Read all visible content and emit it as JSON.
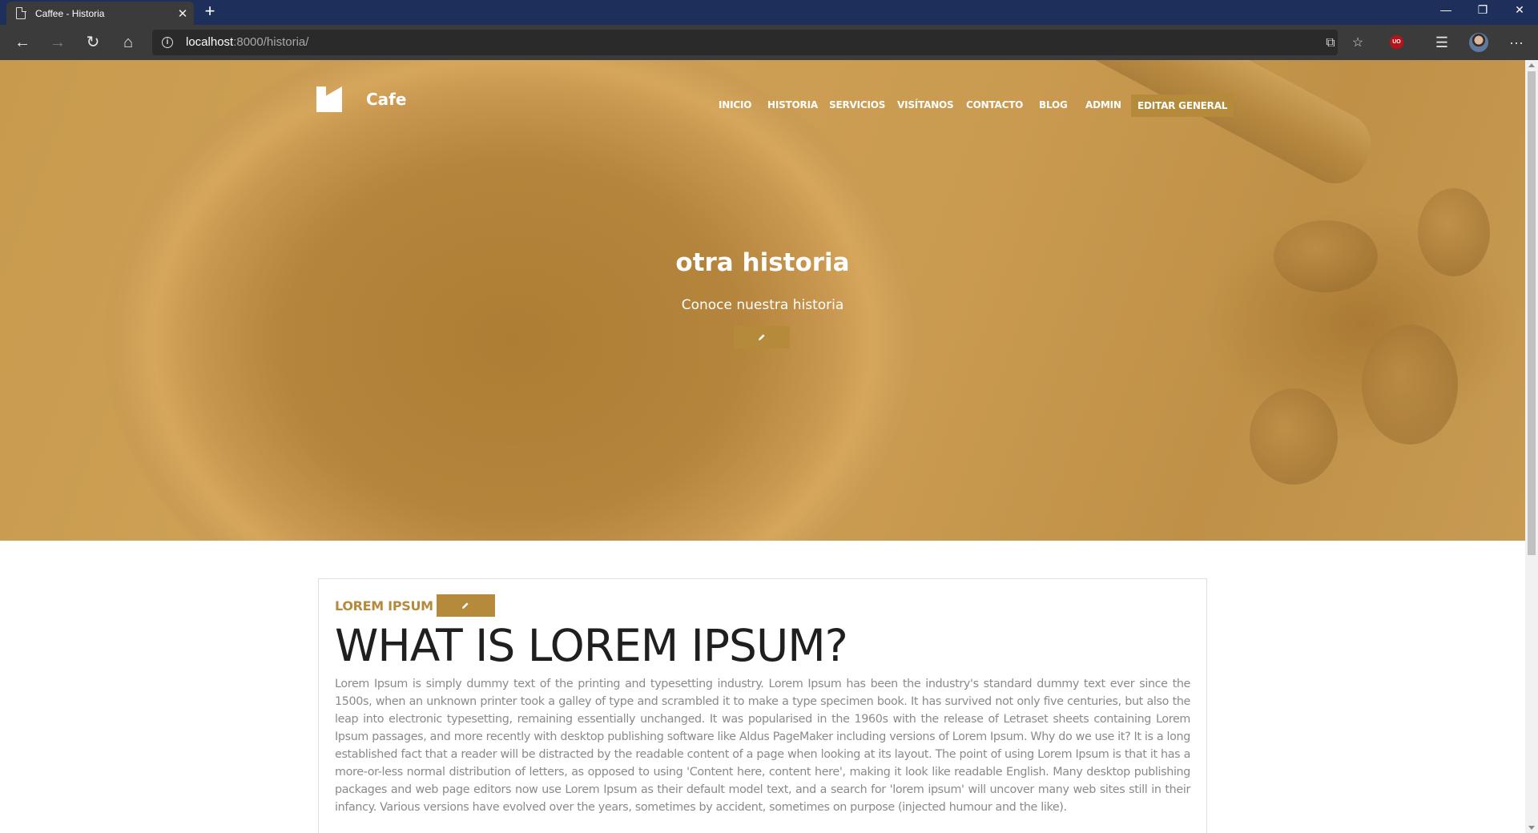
{
  "browser": {
    "tab_title": "Caffee - Historia",
    "url_host": "localhost",
    "url_path": ":8000/historia/"
  },
  "site": {
    "brand": "Cafe",
    "nav": [
      "INICIO",
      "HISTORIA",
      "SERVICIOS",
      "VISÍTANOS",
      "CONTACTO",
      "BLOG",
      "ADMIN"
    ],
    "edit_general": "EDITAR GENERAL"
  },
  "hero": {
    "title": "otra historia",
    "subtitle": "Conoce nuestra historia"
  },
  "content": {
    "label": "LOREM IPSUM",
    "heading": "WHAT IS LOREM IPSUM?",
    "body": "Lorem Ipsum is simply dummy text of the printing and typesetting industry. Lorem Ipsum has been the industry's standard dummy text ever since the 1500s, when an unknown printer took a galley of type and scrambled it to make a type specimen book. It has survived not only five centuries, but also the leap into electronic typesetting, remaining essentially unchanged. It was popularised in the 1960s with the release of Letraset sheets containing Lorem Ipsum passages, and more recently with desktop publishing software like Aldus PageMaker including versions of Lorem Ipsum. Why do we use it? It is a long established fact that a reader will be distracted by the readable content of a page when looking at its layout. The point of using Lorem Ipsum is that it has a more-or-less normal distribution of letters, as opposed to using 'Content here, content here', making it look like readable English. Many desktop publishing packages and web page editors now use Lorem Ipsum as their default model text, and a search for 'lorem ipsum' will uncover many web sites still in their infancy. Various versions have evolved over the years, sometimes by accident, sometimes on purpose (injected humour and the like)."
  },
  "colors": {
    "accent": "#b58a3a",
    "titlebar": "#1f2f5c",
    "toolbar": "#3b3b3b"
  }
}
